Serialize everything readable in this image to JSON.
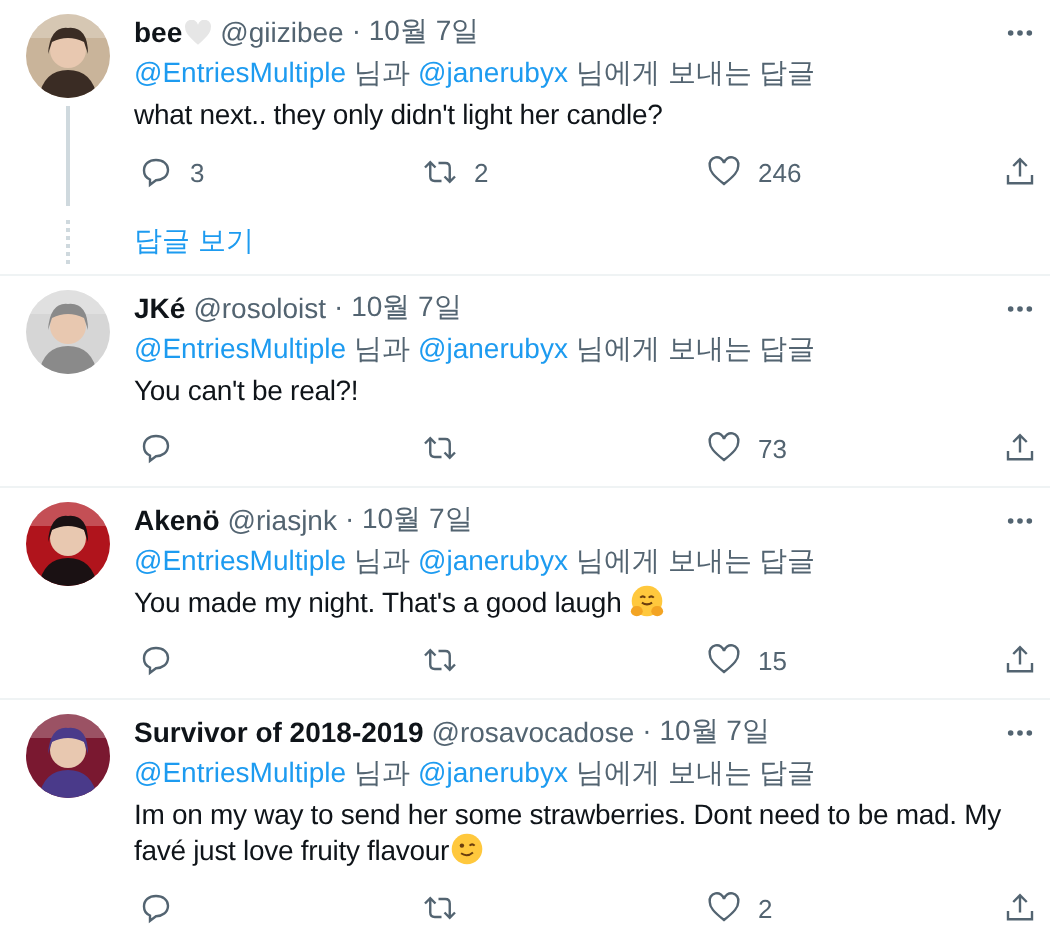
{
  "tweets": [
    {
      "name": "bee",
      "name_heart": true,
      "handle": "@giizibee",
      "date": "· 10월 7일",
      "reply_to": [
        "@EntriesMultiple",
        "님과",
        "@janerubyx",
        "님에게 보내는 답글"
      ],
      "text": "what next.. they only didn't light her candle?",
      "counts": {
        "reply": "3",
        "retweet": "2",
        "like": "246"
      },
      "thread": true,
      "show_replies": "답글 보기"
    },
    {
      "name": "JKé",
      "name_heart": false,
      "handle": "@rosoloist",
      "date": "· 10월 7일",
      "reply_to": [
        "@EntriesMultiple",
        "님과",
        "@janerubyx",
        "님에게 보내는 답글"
      ],
      "text": "You can't be real?!",
      "counts": {
        "like": "73"
      },
      "thread": false
    },
    {
      "name": "Akenö",
      "name_heart": false,
      "handle": "@riasjnk",
      "date": "· 10월 7일",
      "reply_to": [
        "@EntriesMultiple",
        "님과",
        "@janerubyx",
        "님에게 보내는 답글"
      ],
      "text": "You made my night. That's a good laugh",
      "emoji": {
        "kind": "hug"
      },
      "counts": {
        "like": "15"
      },
      "thread": false
    },
    {
      "name": "Survivor of 2018-2019",
      "name_heart": false,
      "handle": "@rosavocadose",
      "date": "· 10월 7일",
      "reply_to": [
        "@EntriesMultiple",
        "님과",
        "@janerubyx",
        "님에게 보내는 답글"
      ],
      "text": "Im on my way to send her some strawberries. Dont need to be mad. My favé just love fruity flavour",
      "emoji": {
        "kind": "wink"
      },
      "counts": {
        "like": "2"
      },
      "thread": false
    }
  ]
}
